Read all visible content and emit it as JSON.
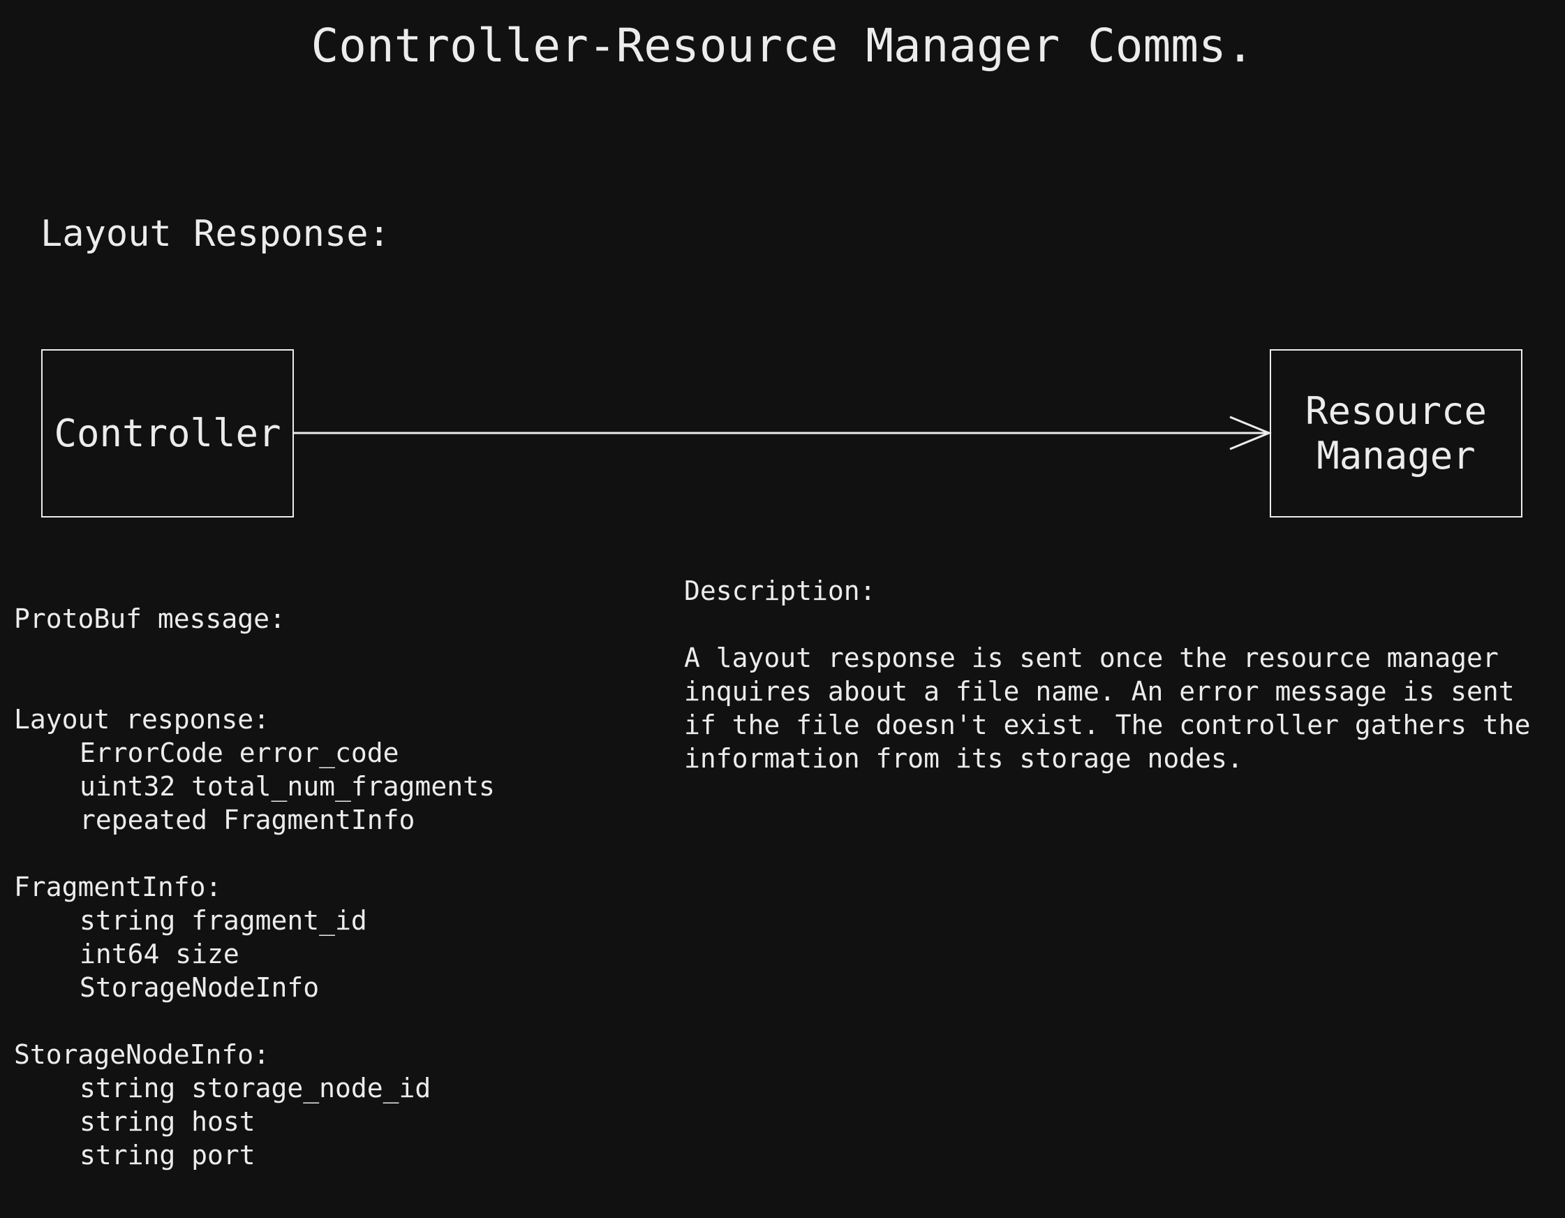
{
  "title": "Controller-Resource Manager Comms.",
  "section_heading": "Layout Response:",
  "nodes": {
    "controller": "Controller",
    "resource_manager": "Resource\nManager"
  },
  "protobuf": {
    "header": "ProtoBuf message:",
    "layout_response": {
      "name": "Layout response:",
      "fields": [
        "ErrorCode error_code",
        "uint32 total_num_fragments",
        "repeated FragmentInfo"
      ]
    },
    "fragment_info": {
      "name": "FragmentInfo:",
      "fields": [
        "string fragment_id",
        "int64 size",
        "StorageNodeInfo"
      ]
    },
    "storage_node_info": {
      "name": "StorageNodeInfo:",
      "fields": [
        "string storage_node_id",
        "string host",
        "string port"
      ]
    }
  },
  "description": {
    "header": "Description:",
    "lines": [
      "A layout response is sent once the resource manager",
      "inquires about a file name. An error message is sent",
      "if the file doesn't exist. The controller gathers the",
      "information from its storage nodes."
    ]
  },
  "colors": {
    "background": "#111111",
    "foreground": "#ececec"
  }
}
